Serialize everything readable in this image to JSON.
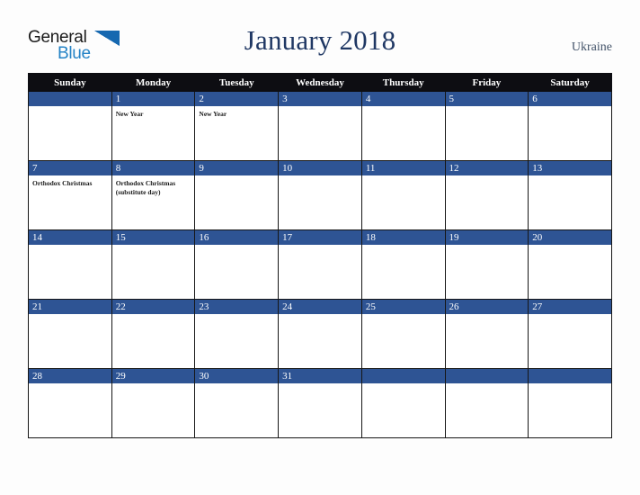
{
  "logo": {
    "text_top": "General",
    "text_bottom": "Blue",
    "icon": "triangle-logo-icon",
    "color_top": "#1a1a1a",
    "color_bottom": "#2583c6",
    "color_triangle": "#1668b0"
  },
  "header": {
    "title": "January 2018",
    "country": "Ukraine",
    "title_color": "#203864",
    "country_color": "#44546a"
  },
  "calendar": {
    "weekday_headers": [
      "Sunday",
      "Monday",
      "Tuesday",
      "Wednesday",
      "Thursday",
      "Friday",
      "Saturday"
    ],
    "header_background": "#0d0d12",
    "daynum_background": "#2e5494",
    "cell_background": "#ffffff",
    "weeks": [
      [
        {
          "day": "",
          "events": []
        },
        {
          "day": "1",
          "events": [
            "New Year"
          ]
        },
        {
          "day": "2",
          "events": [
            "New Year"
          ]
        },
        {
          "day": "3",
          "events": []
        },
        {
          "day": "4",
          "events": []
        },
        {
          "day": "5",
          "events": []
        },
        {
          "day": "6",
          "events": []
        }
      ],
      [
        {
          "day": "7",
          "events": [
            "Orthodox Christmas"
          ]
        },
        {
          "day": "8",
          "events": [
            "Orthodox Christmas (substitute day)"
          ]
        },
        {
          "day": "9",
          "events": []
        },
        {
          "day": "10",
          "events": []
        },
        {
          "day": "11",
          "events": []
        },
        {
          "day": "12",
          "events": []
        },
        {
          "day": "13",
          "events": []
        }
      ],
      [
        {
          "day": "14",
          "events": []
        },
        {
          "day": "15",
          "events": []
        },
        {
          "day": "16",
          "events": []
        },
        {
          "day": "17",
          "events": []
        },
        {
          "day": "18",
          "events": []
        },
        {
          "day": "19",
          "events": []
        },
        {
          "day": "20",
          "events": []
        }
      ],
      [
        {
          "day": "21",
          "events": []
        },
        {
          "day": "22",
          "events": []
        },
        {
          "day": "23",
          "events": []
        },
        {
          "day": "24",
          "events": []
        },
        {
          "day": "25",
          "events": []
        },
        {
          "day": "26",
          "events": []
        },
        {
          "day": "27",
          "events": []
        }
      ],
      [
        {
          "day": "28",
          "events": []
        },
        {
          "day": "29",
          "events": []
        },
        {
          "day": "30",
          "events": []
        },
        {
          "day": "31",
          "events": []
        },
        {
          "day": "",
          "events": []
        },
        {
          "day": "",
          "events": []
        },
        {
          "day": "",
          "events": []
        }
      ]
    ]
  }
}
